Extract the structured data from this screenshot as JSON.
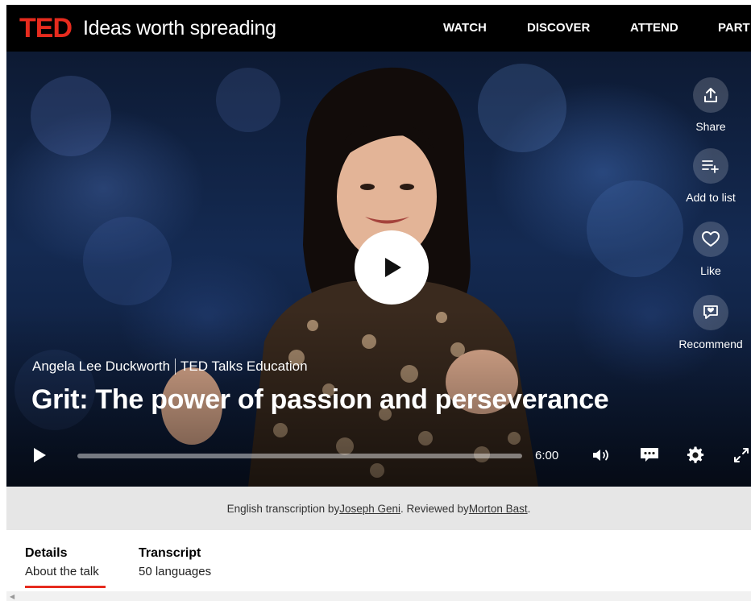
{
  "header": {
    "logo": "TED",
    "tagline": "Ideas worth spreading",
    "nav": [
      "WATCH",
      "DISCOVER",
      "ATTEND",
      "PART"
    ]
  },
  "video": {
    "speaker": "Angela Lee Duckworth",
    "event": "TED Talks Education",
    "title": "Grit: The power of passion and perseverance",
    "duration": "6:00",
    "progress": 0.0,
    "actions": {
      "share": "Share",
      "add_to_list": "Add to list",
      "like": "Like",
      "recommend": "Recommend"
    },
    "icons": [
      "play-icon",
      "share-icon",
      "add-to-list-icon",
      "heart-icon",
      "recommend-icon",
      "volume-icon",
      "captions-icon",
      "gear-icon",
      "fullscreen-icon"
    ]
  },
  "credits": {
    "prefix": "English transcription by ",
    "transcriber": "Joseph Geni",
    "middle": ". Reviewed by ",
    "reviewer": "Morton Bast",
    "suffix": "."
  },
  "tabs": [
    {
      "title": "Details",
      "subtitle": "About the talk",
      "active": true
    },
    {
      "title": "Transcript",
      "subtitle": "50 languages",
      "active": false
    }
  ],
  "colors": {
    "brand_red": "#e62b1e",
    "header_bg": "#000000",
    "credits_bg": "#e6e6e6"
  }
}
